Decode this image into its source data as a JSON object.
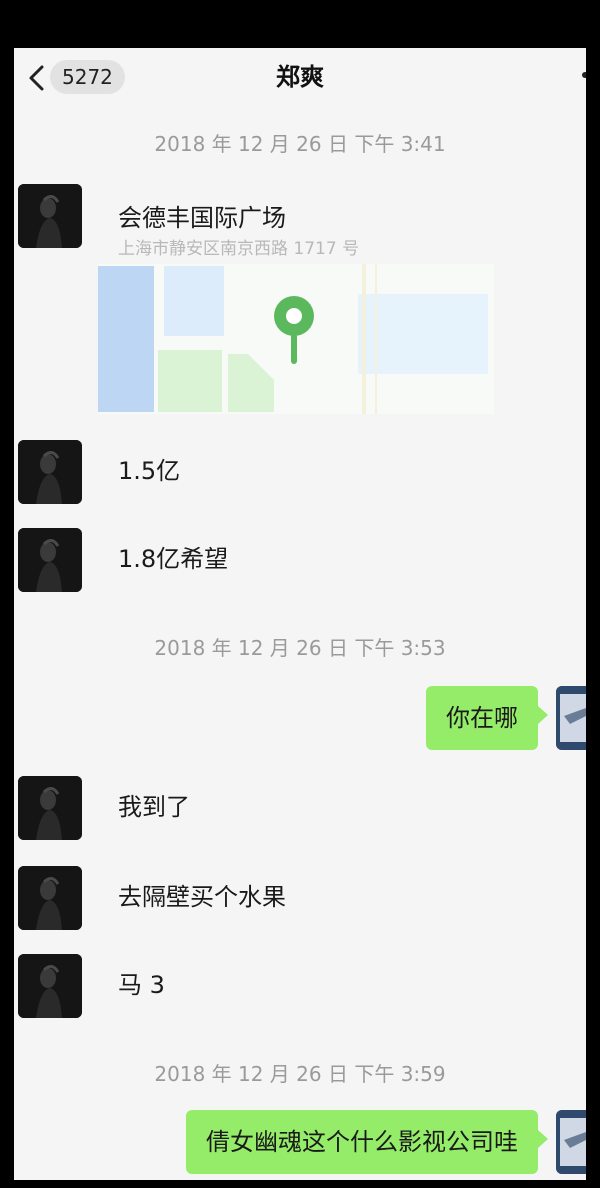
{
  "header": {
    "unread_count": "5272",
    "title": "郑爽"
  },
  "messages": {
    "time1": "2018 年 12 月 26 日  下午 3:41",
    "location_name": "会德丰国际广场",
    "location_address": "上海市静安区南京西路 1717 号",
    "m1": "1.5亿",
    "m2": "1.8亿希望",
    "time2": "2018 年 12 月 26 日  下午 3:53",
    "out1": "你在哪",
    "m3": "我到了",
    "m4": "去隔壁买个水果",
    "m5": "马 3",
    "time3": "2018 年 12 月 26 日  下午 3:59",
    "out2": "倩女幽魂这个什么影视公司哇"
  },
  "icons": {
    "back": "chevron-left-icon",
    "map_pin": "map-pin-icon"
  },
  "colors": {
    "outgoing_bubble": "#95ec69",
    "screen_bg": "#f5f5f5",
    "timestamp_text": "#9a9a9a",
    "map_pin": "#5cb85c"
  }
}
